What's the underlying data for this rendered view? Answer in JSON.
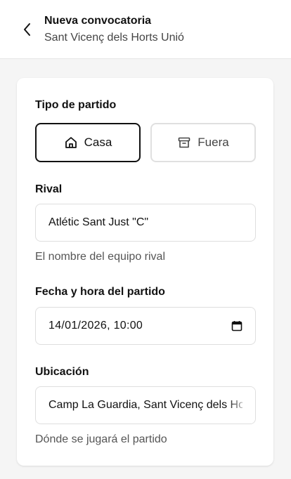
{
  "header": {
    "title": "Nueva convocatoria",
    "subtitle": "Sant Vicenç dels Horts Unió",
    "back_icon": "chevron-left-icon"
  },
  "form": {
    "match_type": {
      "label": "Tipo de partido",
      "options": [
        {
          "label": "Casa",
          "icon": "home-icon",
          "selected": true
        },
        {
          "label": "Fuera",
          "icon": "archive-icon",
          "selected": false
        }
      ]
    },
    "rival": {
      "label": "Rival",
      "value": "Atlétic Sant Just \"C\"",
      "help": "El nombre del equipo rival"
    },
    "datetime": {
      "label": "Fecha y hora del partido",
      "value": "14/01/2026, 10:00",
      "icon": "calendar-icon"
    },
    "location": {
      "label": "Ubicación",
      "value": "Camp La Guardia, Sant Vicenç dels Horts",
      "help": "Dónde se jugará el partido"
    }
  },
  "colors": {
    "background": "#f5f5f5",
    "card": "#ffffff",
    "text": "#111111",
    "muted": "#555555",
    "border": "#dedede",
    "selected_border": "#111111"
  }
}
